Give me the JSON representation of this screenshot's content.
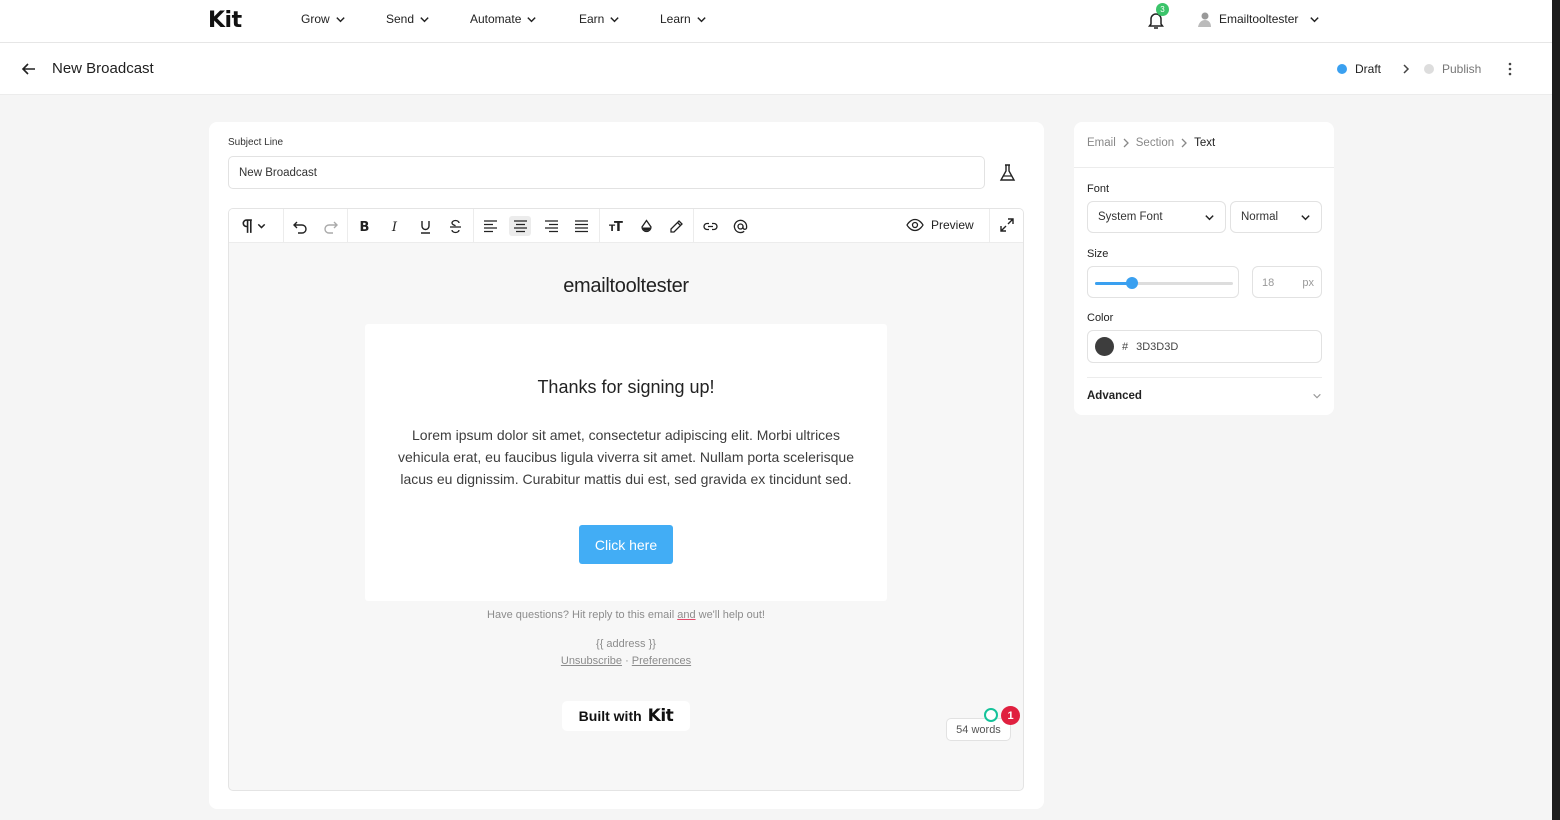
{
  "nav": {
    "logo": "Kit",
    "items": [
      {
        "label": "Grow"
      },
      {
        "label": "Send"
      },
      {
        "label": "Automate"
      },
      {
        "label": "Earn"
      },
      {
        "label": "Learn"
      }
    ],
    "notifications_count": "3",
    "account_name": "Emailtooltester"
  },
  "header": {
    "title": "New Broadcast",
    "status_current": "Draft",
    "status_next": "Publish",
    "draft_color": "#3aa0f0",
    "publish_color": "#dddddd"
  },
  "compose": {
    "subject_label": "Subject Line",
    "subject_value": "New Broadcast",
    "toolbar": {
      "preview_label": "Preview"
    },
    "email": {
      "brand": "emailtooltester",
      "heading": "Thanks for signing up!",
      "body": "Lorem ipsum dolor sit amet, consectetur adipiscing elit. Morbi ultrices vehicula erat, eu faucibus ligula viverra sit amet. Nullam porta scelerisque lacus eu dignissim. Curabitur mattis dui est, sed gravida ex tincidunt sed.",
      "cta_label": "Click here",
      "cta_color": "#42adf5",
      "footer_question_pre": "Have questions? Hit reply to this email ",
      "footer_question_mid": "and",
      "footer_question_post": " we'll help out!",
      "address": "{{ address }}",
      "unsubscribe": "Unsubscribe",
      "link_sep": " · ",
      "preferences": "Preferences",
      "built_with": "Built with",
      "built_with_brand": "Kit"
    },
    "word_count": "54 words",
    "grammar_issues": "1"
  },
  "panel": {
    "breadcrumb": [
      "Email",
      "Section",
      "Text"
    ],
    "font_label": "Font",
    "font_value": "System Font",
    "weight_value": "Normal",
    "size_label": "Size",
    "size_value": "18",
    "size_unit": "px",
    "slider_level": 0.27,
    "color_label": "Color",
    "color_hash": "#",
    "color_value": "3D3D3D",
    "color_hex": "#3D3D3D",
    "advanced_label": "Advanced"
  }
}
